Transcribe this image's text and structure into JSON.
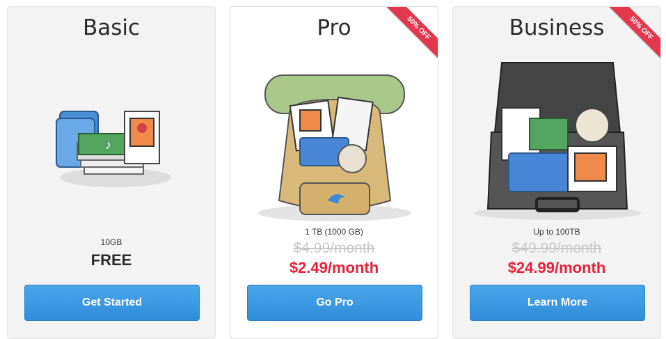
{
  "plans": [
    {
      "title": "Basic",
      "storage": "10GB",
      "price": "FREE",
      "cta": "Get Started"
    },
    {
      "title": "Pro",
      "storage": "1 TB (1000 GB)",
      "old_price": "$4.99/month",
      "price": "$2.49/month",
      "cta": "Go Pro",
      "ribbon": "50% OFF"
    },
    {
      "title": "Business",
      "storage": "Up to 100TB",
      "old_price": "$49.99/month",
      "price": "$24.99/month",
      "cta": "Learn More",
      "ribbon": "50% OFF"
    }
  ],
  "colors": {
    "accent": "#e8203a",
    "button": "#3b9be3",
    "ribbon": "#e2384d"
  }
}
